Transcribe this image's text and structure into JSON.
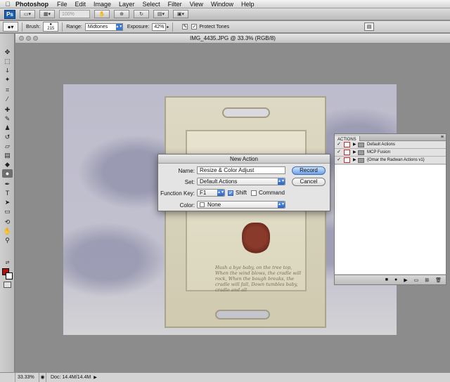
{
  "menubar": {
    "apple": "",
    "app_name": "Photoshop",
    "items": [
      "File",
      "Edit",
      "Image",
      "Layer",
      "Select",
      "Filter",
      "View",
      "Window",
      "Help"
    ]
  },
  "appbar": {
    "logo": "Ps",
    "zoom_value": "100%"
  },
  "options": {
    "brush_label": "Brush:",
    "brush_size": "215",
    "range_label": "Range:",
    "range_value": "Midtones",
    "exposure_label": "Exposure:",
    "exposure_value": "42%",
    "protect_label": "Protect Tones",
    "protect_checked": "✓"
  },
  "document": {
    "title": "IMG_4435.JPG @ 33.3% (RGB/8)"
  },
  "photo": {
    "poem": "Hush a bye baby, on the tree top, When the wind blows, the cradle will rock, When the bough breaks, the cradle will fall, Down tumbles baby, cradle and all"
  },
  "actions_panel": {
    "tab": "ACTIONS",
    "menu_icon": "≡",
    "items": [
      {
        "check": "✓",
        "label": "Default Actions"
      },
      {
        "check": "✓",
        "label": "MCP Fusion"
      },
      {
        "check": "✓",
        "label": "{Omar the Radwan Actions v1}"
      }
    ],
    "footer_icons": [
      "■",
      "●",
      "▶",
      "▭",
      "⊞",
      "🗑"
    ]
  },
  "dialog": {
    "title": "New Action",
    "name_label": "Name:",
    "name_value": "Resize & Color Adjust",
    "set_label": "Set:",
    "set_value": "Default Actions",
    "fkey_label": "Function Key:",
    "fkey_value": "F1",
    "shift_label": "Shift",
    "shift_checked": "✓",
    "command_label": "Command",
    "color_label": "Color:",
    "color_value": "None",
    "record_label": "Record",
    "cancel_label": "Cancel"
  },
  "status": {
    "zoom": "33.33%",
    "docinfo": "Doc: 14.4M/14.4M"
  },
  "colors": {
    "foreground": "#b01010",
    "background": "#ffffff",
    "accent": "#3a78d8"
  }
}
